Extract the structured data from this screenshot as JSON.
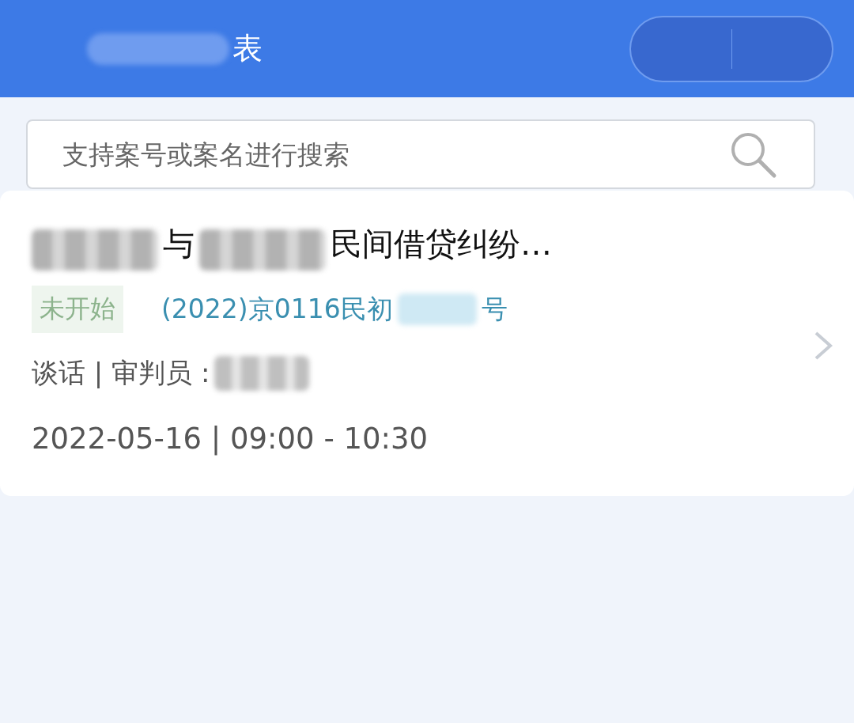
{
  "header": {
    "title_parts": [
      {
        "kind": "redacted"
      },
      {
        "kind": "text",
        "text": "表"
      }
    ],
    "capsule": {
      "kind": "blank"
    }
  },
  "search": {
    "placeholder": "支持案号或案名进行搜索"
  },
  "cases": [
    {
      "title_parts": [
        {
          "kind": "redacted"
        },
        {
          "kind": "text",
          "text": "与"
        },
        {
          "kind": "redacted"
        },
        {
          "kind": "text",
          "text": "民间借贷纠纷…"
        }
      ],
      "status": "未开始",
      "case_number_parts": [
        {
          "kind": "text",
          "text": "(2022)京0116民初"
        },
        {
          "kind": "redacted"
        },
        {
          "kind": "text",
          "text": "号"
        }
      ],
      "judge_parts": [
        {
          "kind": "text",
          "text": "谈话 | 审判员 :"
        },
        {
          "kind": "redacted"
        }
      ],
      "time": "2022-05-16 | 09:00 - 10:30"
    }
  ]
}
